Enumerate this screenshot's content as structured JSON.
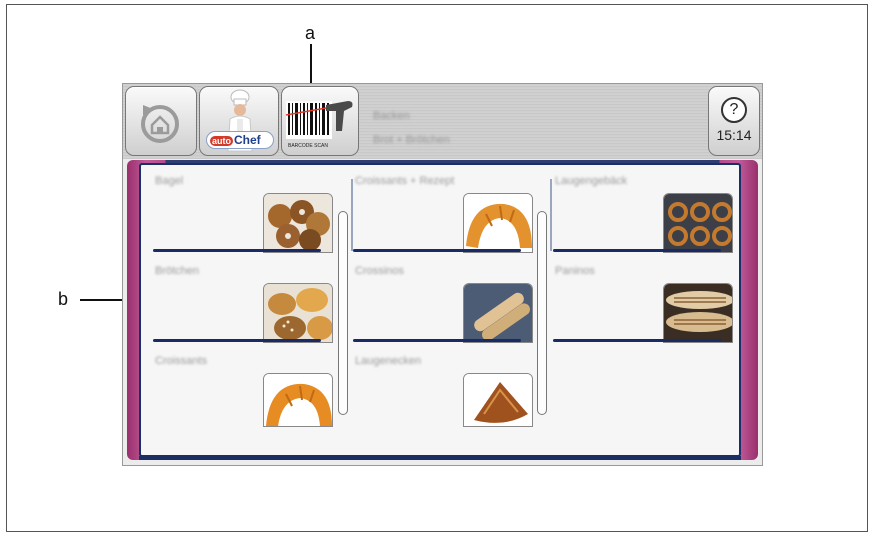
{
  "callouts": {
    "a": "a",
    "b": "b"
  },
  "header": {
    "back_icon": "home-back-icon",
    "autochef_logo_auto": "auto",
    "autochef_logo_chef": "Chef",
    "barcode_caption": "BARCODE SCAN",
    "title_line1": "Backen",
    "title_line2": "Brot + Brötchen",
    "help_symbol": "?",
    "time": "15:14"
  },
  "tiles": [
    {
      "label": "Bagel",
      "image": "bagels"
    },
    {
      "label": "Croissants + Rezept",
      "image": "croissant"
    },
    {
      "label": "Laugengebäck",
      "image": "pretzels"
    },
    {
      "label": "Brötchen",
      "image": "rolls"
    },
    {
      "label": "Crossinos",
      "image": "baguettes"
    },
    {
      "label": "Paninos",
      "image": "panini"
    },
    {
      "label": "Croissants",
      "image": "croissant"
    },
    {
      "label": "Laugenecken",
      "image": "pastry-wedge"
    }
  ],
  "colors": {
    "accent_magenta": "#b34c8b",
    "frame_navy": "#1c2e66"
  }
}
